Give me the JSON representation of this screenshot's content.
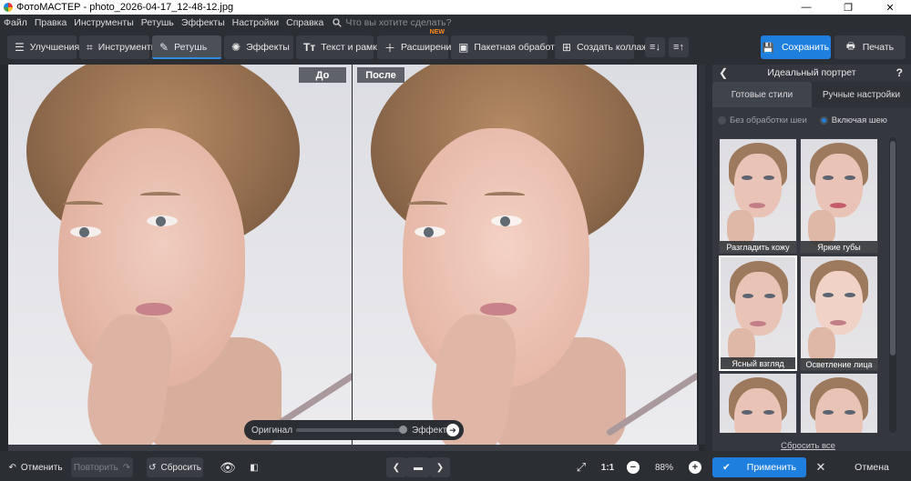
{
  "window": {
    "title": "ФотоМАСТЕР - photo_2026-04-17_12-48-12.jpg",
    "minimize": "—",
    "maximize": "❐",
    "close": "✕"
  },
  "menu": {
    "items": [
      "Файл",
      "Правка",
      "Инструменты",
      "Ретушь",
      "Эффекты",
      "Настройки",
      "Справка"
    ],
    "search_placeholder": "Что вы хотите сделать?"
  },
  "toolbar": {
    "tabs": [
      {
        "label": "Улучшения",
        "icon": "sliders-icon"
      },
      {
        "label": "Инструменты",
        "icon": "crop-icon"
      },
      {
        "label": "Ретушь",
        "icon": "brush-icon",
        "active": true
      },
      {
        "label": "Эффекты",
        "icon": "sparkle-icon"
      },
      {
        "label": "Текст и рамки",
        "icon": "text-icon"
      },
      {
        "label": "Расширения",
        "icon": "plus-icon",
        "badge": "NEW"
      },
      {
        "label": "Пакетная обработка",
        "icon": "images-icon"
      },
      {
        "label": "Создать коллаж",
        "icon": "collage-icon"
      }
    ],
    "save_label": "Сохранить",
    "print_label": "Печать",
    "accent": "#1e7fde"
  },
  "canvas": {
    "before_label": "До",
    "after_label": "После",
    "slider": {
      "left_label": "Оригинал",
      "right_label": "Эффект",
      "value": 0.93
    }
  },
  "panel": {
    "title": "Идеальный портрет",
    "tabs": [
      "Готовые стили",
      "Ручные настройки"
    ],
    "radio_options": [
      {
        "label": "Без обработки шеи",
        "selected": false
      },
      {
        "label": "Включая шею",
        "selected": true
      }
    ],
    "presets": [
      {
        "label": "Разгладить кожу",
        "selected": false
      },
      {
        "label": "Яркие губы",
        "selected": false
      },
      {
        "label": "Ясный взгляд",
        "selected": true
      },
      {
        "label": "Осветление лица",
        "selected": false
      },
      {
        "label": "",
        "selected": false
      },
      {
        "label": "",
        "selected": false
      }
    ],
    "reset_all": "Сбросить все"
  },
  "bottom": {
    "undo": "Отменить",
    "redo": "Повторить",
    "reset": "Сбросить",
    "ratio": "1:1",
    "zoom": "88%",
    "apply": "Применить",
    "cancel": "Отмена"
  }
}
